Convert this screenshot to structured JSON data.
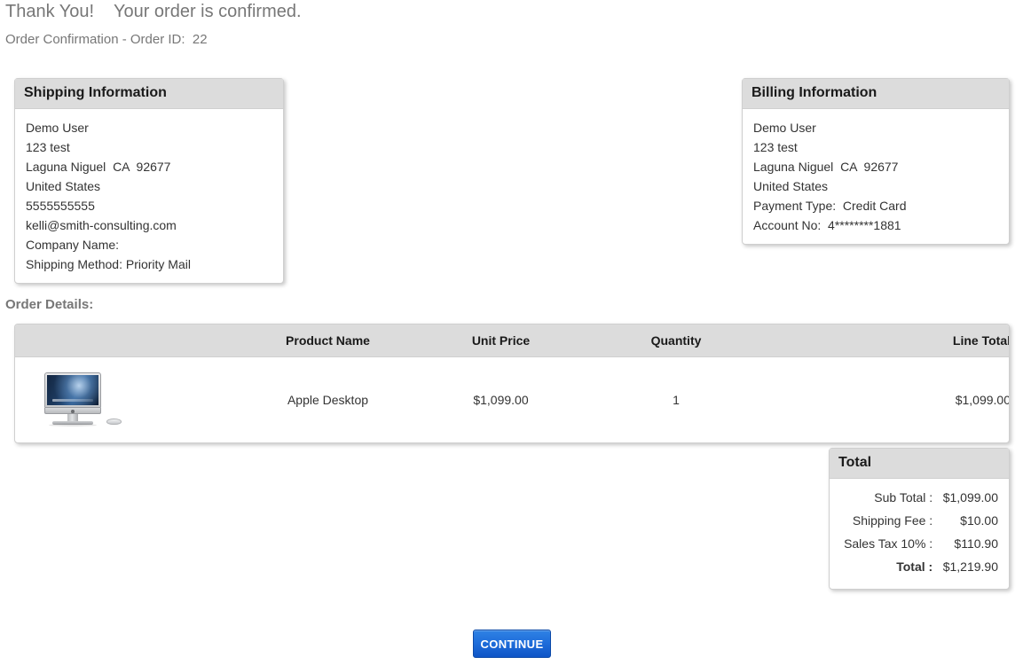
{
  "header": {
    "thank_you": "Thank You!    Your order is confirmed.",
    "order_confirmation": "Order Confirmation - Order ID:  22"
  },
  "shipping": {
    "title": "Shipping Information",
    "lines": [
      "Demo User",
      "123 test",
      "Laguna Niguel  CA  92677",
      "United States",
      "5555555555",
      "kelli@smith-consulting.com",
      "Company Name:",
      "Shipping Method: Priority Mail"
    ]
  },
  "billing": {
    "title": "Billing Information",
    "lines": [
      "Demo User",
      "123 test",
      "Laguna Niguel  CA  92677",
      "United States",
      "Payment Type:  Credit Card",
      "Account No:  4********1881"
    ]
  },
  "order_details": {
    "label": "Order Details:",
    "columns": {
      "image": "",
      "product_name": "Product Name",
      "unit_price": "Unit Price",
      "quantity": "Quantity",
      "line_total": "Line Total"
    },
    "rows": [
      {
        "image_alt": "apple-desktop-imac-thumbnail",
        "product_name": "Apple Desktop",
        "unit_price": "$1,099.00",
        "quantity": "1",
        "line_total": "$1,099.00"
      }
    ]
  },
  "total_panel": {
    "title": "Total",
    "rows": [
      {
        "label": "Sub Total :",
        "value": "$1,099.00",
        "bold": false
      },
      {
        "label": "Shipping Fee :",
        "value": "$10.00",
        "bold": false
      },
      {
        "label": "Sales Tax 10% :",
        "value": "$110.90",
        "bold": false
      },
      {
        "label": "Total :",
        "value": "$1,219.90",
        "bold": true
      }
    ]
  },
  "actions": {
    "continue_label": "CONTINUE"
  },
  "colors": {
    "panel_header_bg": "#dcdcdc",
    "heading_text": "#777777",
    "body_text": "#333333",
    "button_blue": "#1f6edb",
    "page_bg": "#ffffff"
  }
}
